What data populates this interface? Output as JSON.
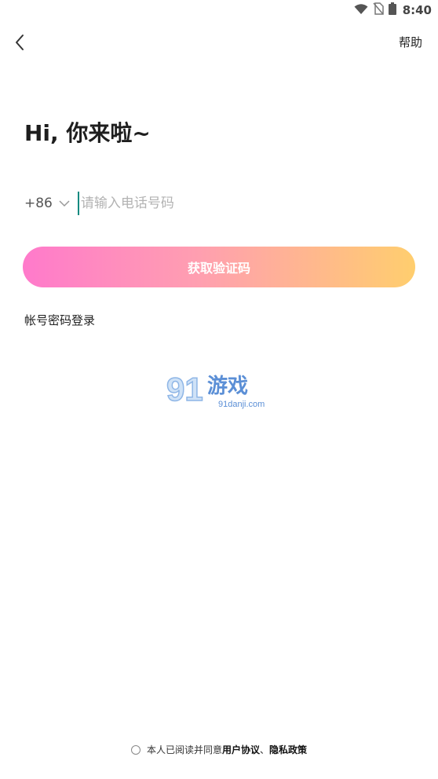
{
  "status_bar": {
    "time": "8:40"
  },
  "header": {
    "help_label": "帮助"
  },
  "greeting": "Hi, 你来啦~",
  "phone": {
    "country_code": "+86",
    "placeholder": "请输入电话号码"
  },
  "get_code_button": "获取验证码",
  "account_login_link": "帐号密码登录",
  "watermark": {
    "logo_text": "91游戏",
    "site": "91danji.com"
  },
  "agreement": {
    "prefix": "本人已阅读并同意",
    "user_agreement": "用户协议",
    "separator": "、",
    "privacy_policy": "隐私政策"
  },
  "colors": {
    "gradient_start": "#ff7acb",
    "gradient_end": "#ffce6e",
    "cursor": "#0e8a80"
  }
}
